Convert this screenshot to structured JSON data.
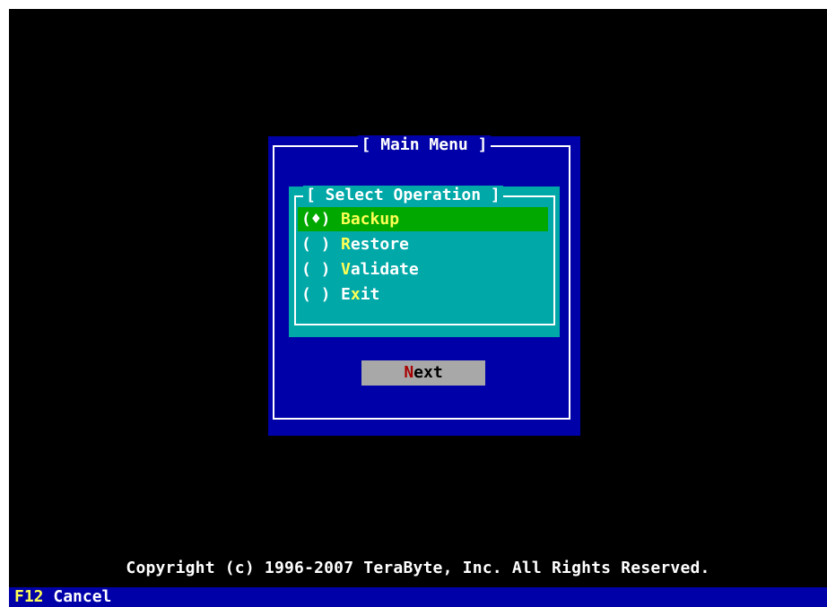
{
  "main_menu": {
    "title": "[ Main Menu ]"
  },
  "select_operation": {
    "title": "[ Select Operation ]",
    "options": [
      {
        "radio": "(♦)",
        "hotkey": "B",
        "rest": "ackup",
        "selected": true
      },
      {
        "radio": "( )",
        "hotkey": "R",
        "rest": "estore",
        "selected": false
      },
      {
        "radio": "( )",
        "hotkey": "V",
        "rest": "alidate",
        "selected": false
      },
      {
        "radio": "( )",
        "pre": "E",
        "hotkey": "x",
        "rest": "it",
        "selected": false
      }
    ]
  },
  "next_button": {
    "hotkey": "N",
    "rest": "ext"
  },
  "footer": {
    "copyright": "Copyright (c) 1996-2007 TeraByte, Inc.  All Rights Reserved."
  },
  "status_bar": {
    "key": "F12",
    "action": "Cancel"
  },
  "colors": {
    "screen_bg": "#000000",
    "window_bg": "#0000a8",
    "group_bg": "#00a8a8",
    "selected_bg": "#00a800",
    "hotkey": "#ffff54",
    "button_bg": "#a8a8a8",
    "button_hotkey": "#a80000"
  }
}
